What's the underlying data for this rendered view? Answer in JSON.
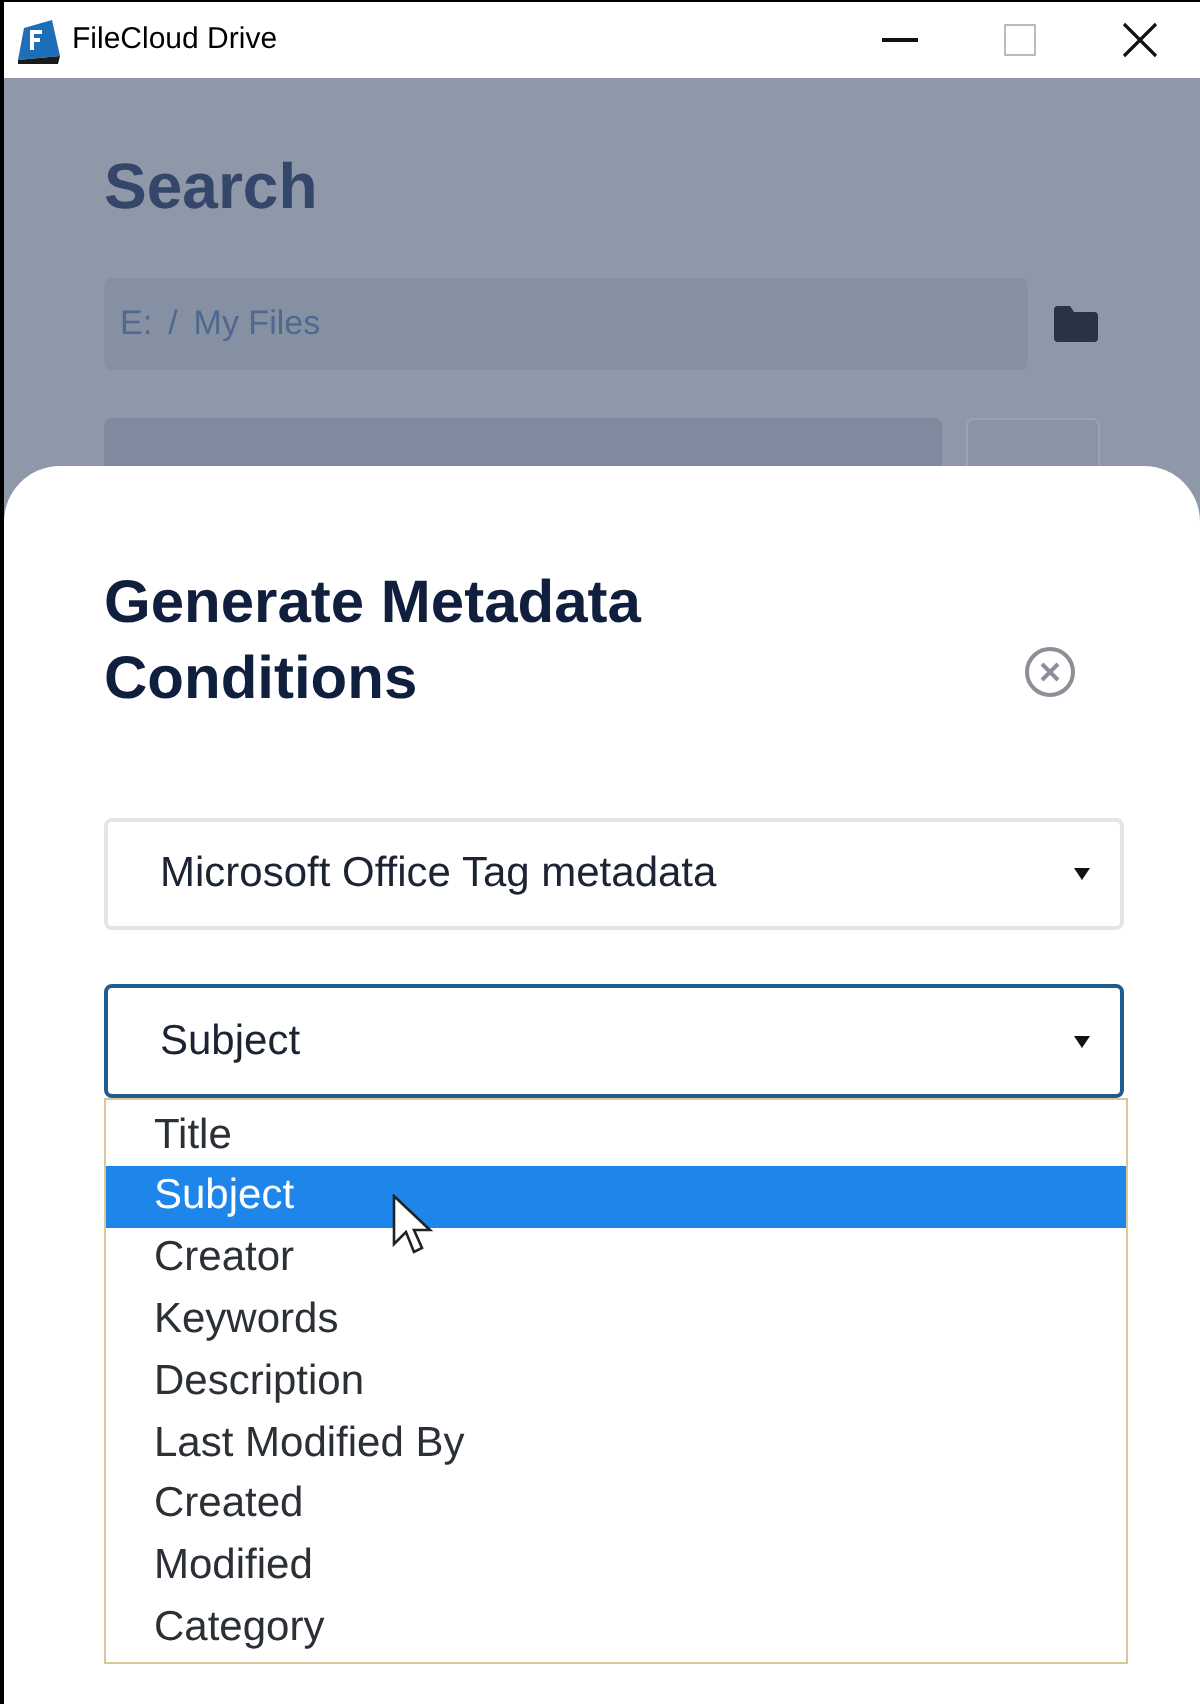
{
  "window": {
    "title": "FileCloud Drive"
  },
  "background": {
    "title": "Search",
    "path": [
      "E:",
      "/",
      "My Files"
    ]
  },
  "dialog": {
    "title": "Generate Metadata Conditions",
    "type_select": {
      "value": "Microsoft Office Tag metadata"
    },
    "field_select": {
      "value": "Subject",
      "expanded": true
    },
    "options": [
      {
        "label": "Title",
        "selected": false
      },
      {
        "label": "Subject",
        "selected": true
      },
      {
        "label": "Creator",
        "selected": false
      },
      {
        "label": "Keywords",
        "selected": false
      },
      {
        "label": "Description",
        "selected": false
      },
      {
        "label": "Last Modified By",
        "selected": false
      },
      {
        "label": "Created",
        "selected": false
      },
      {
        "label": "Modified",
        "selected": false
      },
      {
        "label": "Category",
        "selected": false
      }
    ]
  }
}
